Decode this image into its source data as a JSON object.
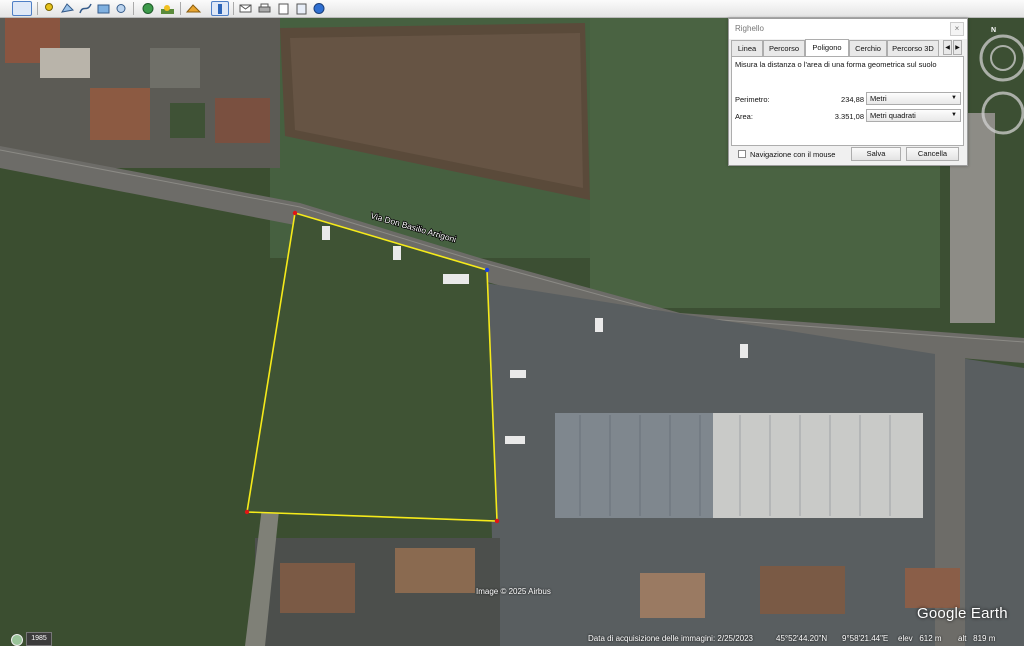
{
  "toolbar": {
    "buttons": [
      "sidebar-toggle-icon",
      "add-placemark-icon",
      "add-polygon-icon",
      "add-path-icon",
      "add-image-overlay-icon",
      "record-tour-icon",
      "historical-imagery-icon",
      "sunlight-icon",
      "switch-to-sky-icon",
      "ruler-icon",
      "email-icon",
      "print-icon",
      "save-image-icon",
      "view-in-maps-icon"
    ]
  },
  "ruler": {
    "title": "Righello",
    "close": "×",
    "tabs": [
      "Linea",
      "Percorso",
      "Poligono",
      "Cerchio",
      "Percorso 3D"
    ],
    "active_tab": "Poligono",
    "description": "Misura la distanza o l'area di una forma geometrica sul suolo",
    "perimeter_label": "Perimetro:",
    "perimeter_value": "234,88",
    "perimeter_unit": "Metri",
    "area_label": "Area:",
    "area_value": "3.351,08",
    "area_unit": "Metri quadrati",
    "mouse_nav_label": "Navigazione con il mouse",
    "save_label": "Salva",
    "cancel_label": "Cancella"
  },
  "map": {
    "street_label": "Via Don Basilio Arrigoni",
    "credit": "Image © 2025 Airbus",
    "brand": "Google Earth",
    "polygon_color": "#f5ea1a"
  },
  "status": {
    "year": "1985",
    "acquisition": "Data di acquisizione delle immagini: 2/25/2023",
    "lat": "45°52'44.20\"N",
    "lon": "9°58'21.44\"E",
    "elev": "elev   612 m",
    "alt": "alt   819 m"
  }
}
